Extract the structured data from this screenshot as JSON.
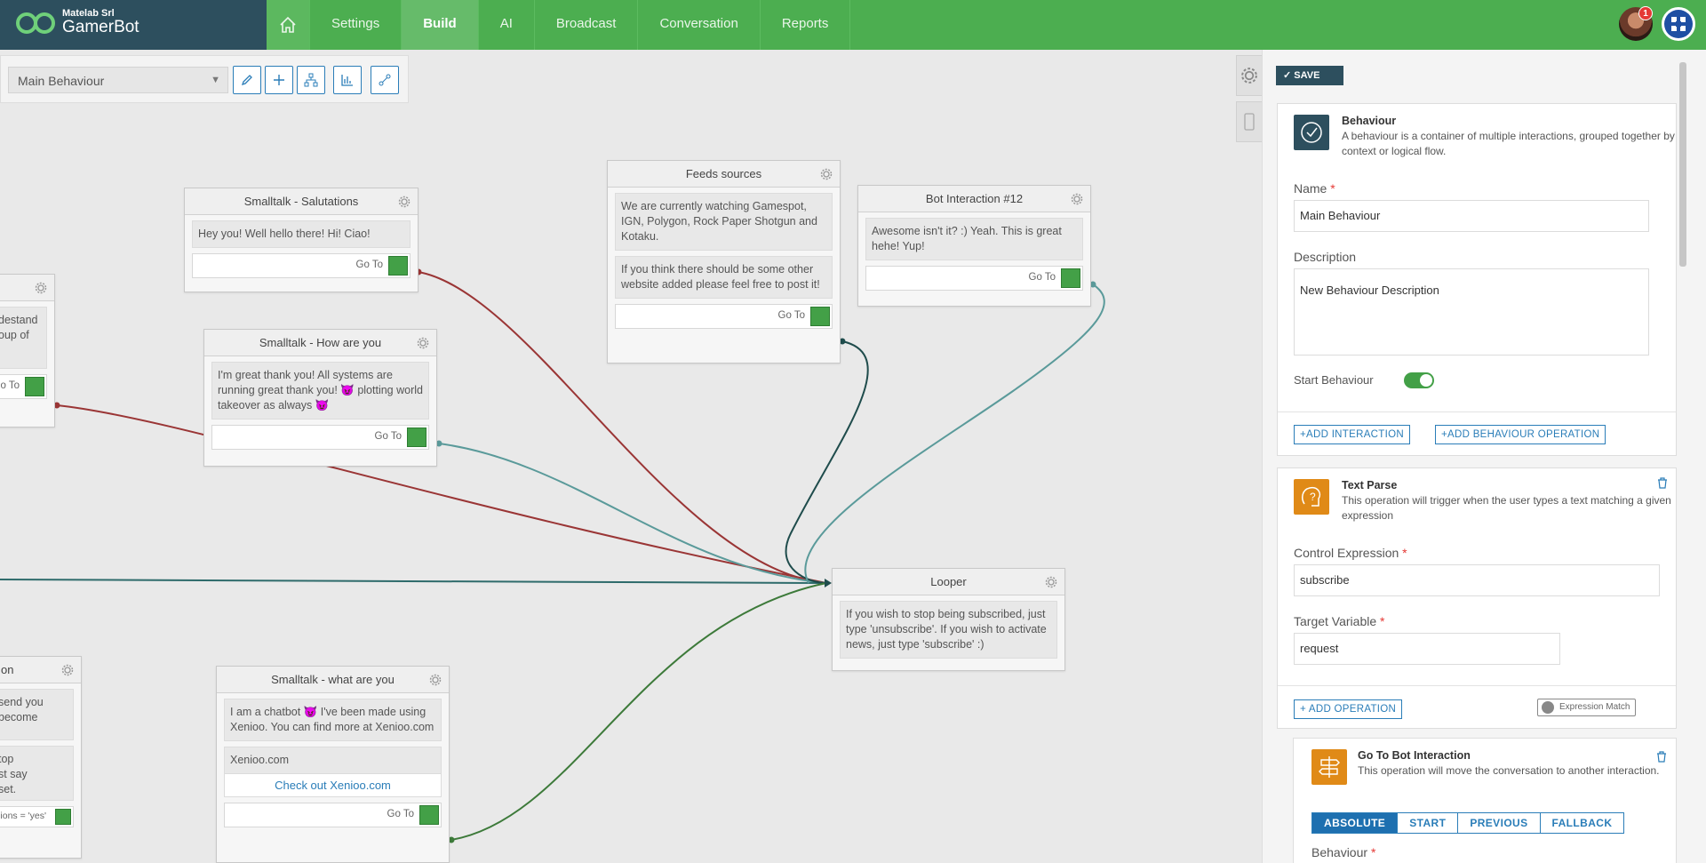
{
  "app": {
    "org": "Matelab Srl",
    "name": "GamerBot",
    "notifications": "1"
  },
  "nav": {
    "settings": "Settings",
    "build": "Build",
    "ai": "AI",
    "broadcast": "Broadcast",
    "conversation": "Conversation",
    "reports": "Reports"
  },
  "toolbar": {
    "behaviour_select": "Main Behaviour"
  },
  "goto_label": "Go To",
  "nodes": {
    "partial_left_top": {
      "text": "destand\noup of",
      "goto": "o To"
    },
    "salutations": {
      "title": "Smalltalk - Salutations",
      "text": "Hey you! Well hello there! Hi! Ciao!"
    },
    "how_are_you": {
      "title": "Smalltalk - How are you",
      "text": "I'm great thank you! All systems are running great thank you! 😈 plotting world takeover as always 😈"
    },
    "feeds": {
      "title": "Feeds sources",
      "text1": "We are currently watching Gamespot, IGN, Polygon, Rock Paper Shotgun and Kotaku.",
      "text2": "If you think there should be some other website added please feel free to post it!"
    },
    "bot12": {
      "title": "Bot Interaction #12",
      "text": "Awesome isn't it? :) Yeah. This is great hehe! Yup!"
    },
    "looper": {
      "title": "Looper",
      "text": "If you wish to stop being subscribed, just type 'unsubscribe'. If you wish to activate news, just type 'subscribe' :)"
    },
    "what_are_you": {
      "title": "Smalltalk - what are you",
      "text": "I am a chatbot 😈 I've been made using Xenioo. You can find more at Xenioo.com",
      "link_text": "Xenioo.com",
      "link_button": "Check out Xenioo.com"
    },
    "partial_left_bottom": {
      "title": "on",
      "text1": "send you\nbecome",
      "text2": "top\nst say\nset.",
      "goto": "ions = 'yes'"
    }
  },
  "panel": {
    "save": "SAVE",
    "behaviour": {
      "title": "Behaviour",
      "desc": "A behaviour is a container of multiple interactions, grouped together by context or logical flow.",
      "name_label": "Name",
      "name_value": "Main Behaviour",
      "desc_label": "Description",
      "desc_value": "New Behaviour Description",
      "start_label": "Start Behaviour",
      "add_interaction": "+ADD INTERACTION",
      "add_operation": "+ADD BEHAVIOUR OPERATION"
    },
    "text_parse": {
      "title": "Text Parse",
      "desc": "This operation will trigger when the user types a text matching a given expression",
      "control_label": "Control Expression",
      "control_value": "subscribe",
      "target_label": "Target Variable",
      "target_value": "request",
      "add_op": "+ ADD OPERATION",
      "expr_match": "Expression Match"
    },
    "goto_bot": {
      "title": "Go To Bot Interaction",
      "desc": "This operation will move the conversation to another interaction.",
      "tabs": [
        "ABSOLUTE",
        "START",
        "PREVIOUS",
        "FALLBACK"
      ],
      "behaviour_label": "Behaviour"
    }
  },
  "colors": {
    "topbar": "#4cae50",
    "brand": "#2d4f5e",
    "link_red": "#9a3535",
    "link_teal": "#5a9a9a",
    "link_dark": "#1f4c4c",
    "link_green": "#3d7a3a"
  }
}
